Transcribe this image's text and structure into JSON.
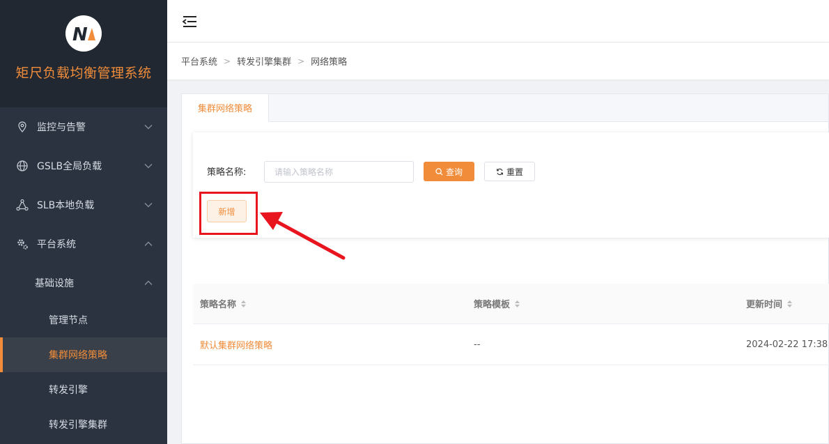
{
  "app": {
    "title": "矩尺负载均衡管理系统",
    "logo_letter": "N",
    "colors": {
      "accent": "#f08c3a",
      "sidebar_bg": "#2b3340",
      "brand_bg": "#222831",
      "annotation": "#e8141e"
    }
  },
  "sidebar": {
    "items": [
      {
        "label": "监控与告警",
        "icon": "location-pin-icon",
        "expanded": false
      },
      {
        "label": "GSLB全局负载",
        "icon": "globe-icon",
        "expanded": false
      },
      {
        "label": "SLB本地负载",
        "icon": "network-nodes-icon",
        "expanded": false
      },
      {
        "label": "平台系统",
        "icon": "gear-icon",
        "expanded": true
      }
    ],
    "sub_group": {
      "label": "基础设施",
      "expanded": true
    },
    "sub_items": [
      {
        "label": "管理节点",
        "active": false
      },
      {
        "label": "集群网络策略",
        "active": true
      },
      {
        "label": "转发引擎",
        "active": false
      },
      {
        "label": "转发引擎集群",
        "active": false
      }
    ]
  },
  "breadcrumb": [
    "平台系统",
    "转发引擎集群",
    "网络策略"
  ],
  "tabs": [
    {
      "label": "集群网络策略",
      "active": true
    }
  ],
  "search": {
    "label": "策略名称:",
    "placeholder": "请输入策略名称",
    "value": "",
    "query_label": "查询",
    "reset_label": "重置"
  },
  "add_label": "新增",
  "table": {
    "headers": [
      "策略名称",
      "策略模板",
      "更新时间"
    ],
    "rows": [
      {
        "name": "默认集群网络策略",
        "template": "--",
        "updated": "2024-02-22 17:38"
      }
    ]
  }
}
